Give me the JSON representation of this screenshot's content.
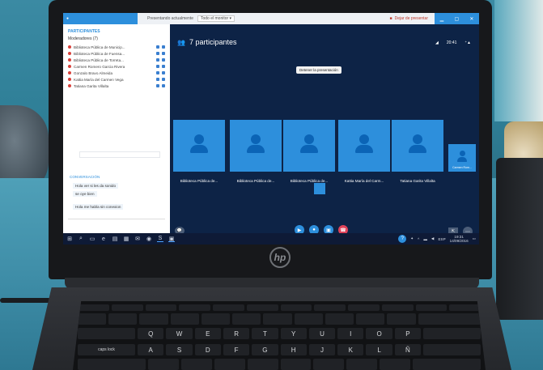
{
  "meeting": {
    "participants_count_title": "7 participantes",
    "tooltip": "Detener la presentación",
    "topbar_text": "Presentando actualmente",
    "topbar_select": "Todo el monitor ▾",
    "topbar_action": "Dejar de presentar",
    "stage_right": [
      "◢",
      "20:41",
      "⁺▲"
    ]
  },
  "sidebar": {
    "title": "PARTICIPANTES",
    "subtitle": "Moderadores (7)",
    "participants": [
      "Biblioteca Pública de Municip...",
      "Biblioteca Pública de Fuensa...",
      "Biblioteca Pública de Torreta...",
      "Carmen Romero Garcia Rivera",
      "Gonzalo Bravo Almeida",
      "Kattia María del Carmen Vega",
      "Tatiana Garita Villalta"
    ],
    "chat_title": "CONVERSACIÓN",
    "chat_messages": [
      "Hola ver si les da sonido",
      "se oye bien",
      "Hola me habla sin conexion"
    ]
  },
  "tiles": [
    {
      "name": "Biblioteca Pública de..."
    },
    {
      "name": "Biblioteca Pública de..."
    },
    {
      "name": "Biblioteca Pública de..."
    },
    {
      "name": "Kattia María del Carm..."
    },
    {
      "name": "Tatiana Garita Villalta"
    },
    {
      "name": "Carmen Rom..."
    }
  ],
  "taskbar": {
    "clock_time": "19:31",
    "clock_date": "14/09/2016",
    "lang": "ESP"
  },
  "laptop": {
    "brand": "hp"
  },
  "keyboard": {
    "row1": [
      "Q",
      "W",
      "E",
      "R",
      "T",
      "Y",
      "U",
      "I",
      "O",
      "P"
    ],
    "row2": [
      "A",
      "S",
      "D",
      "F",
      "G",
      "H",
      "J",
      "K",
      "L",
      "Ñ"
    ],
    "caps": "caps lock"
  },
  "colors": {
    "accent": "#2d8fdc",
    "stage_bg": "#0d2346",
    "end_call": "#e0435a"
  }
}
